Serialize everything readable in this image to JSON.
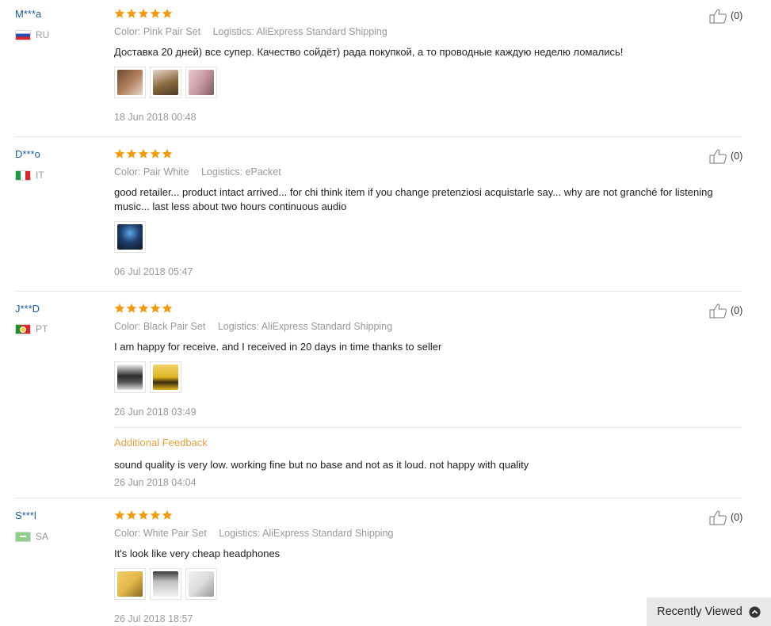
{
  "reviews": [
    {
      "user": "M***a",
      "country": "RU",
      "flag": "ru",
      "stars": 5,
      "color": "Color: Pink Pair Set",
      "logistics": "Logistics: AliExpress Standard Shipping",
      "text": "Доставка 20 дней) все супер. Качество сойдёт) рада покупкой, а то проводные каждую неделю ломались!",
      "photos": [
        "#b07d5a",
        "#8a6a3e",
        "#c89aa3"
      ],
      "date": "18 Jun 2018 00:48",
      "helpful": "(0)"
    },
    {
      "user": "D***o",
      "country": "IT",
      "flag": "it",
      "stars": 5,
      "color": "Color: Pair White",
      "logistics": "Logistics: ePacket",
      "text": "good retailer... product intact arrived... for chi think item if you change pretenziosi acquistarle say... why are not granché for listening music... last less about two hours continuous audio",
      "photos": [
        "#1f3f6e"
      ],
      "date": "06 Jul 2018 05:47",
      "helpful": "(0)"
    },
    {
      "user": "J***D",
      "country": "PT",
      "flag": "pt",
      "stars": 5,
      "color": "Color: Black Pair Set",
      "logistics": "Logistics: AliExpress Standard Shipping",
      "text": "I am happy for receive. and I received in 20 days in time thanks to seller",
      "photos": [
        "#2b2b2b",
        "#e0b320"
      ],
      "date": "26 Jun 2018 03:49",
      "additional": {
        "label": "Additional Feedback",
        "text": "sound quality is very low. working fine but no base and not as it loud. not happy with quality",
        "date": "26 Jun 2018 04:04"
      },
      "helpful": "(0)"
    },
    {
      "user": "S***l",
      "country": "SA",
      "flag": "sa",
      "stars": 5,
      "color": "Color: White Pair Set",
      "logistics": "Logistics: AliExpress Standard Shipping",
      "text": "It's look like very cheap headphones",
      "photos": [
        "#e3b84a",
        "#bfbfbf",
        "#dcdcdc"
      ],
      "date": "26 Jul 2018 18:57",
      "helpful": "(0)"
    }
  ],
  "recently_viewed": {
    "label": "Recently Viewed",
    "icon": "chevron-up-circle-icon"
  },
  "colors": {
    "star": "#f29b11",
    "link": "#1b5a9e",
    "muted": "#999999",
    "additional_feedback": "#e8a040"
  }
}
